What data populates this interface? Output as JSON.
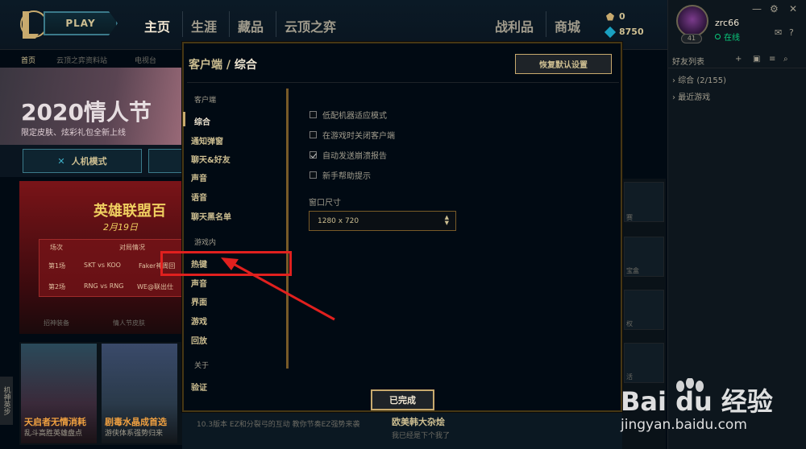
{
  "topbar": {
    "play_label": "PLAY",
    "nav": [
      "主页",
      "生涯",
      "藏品",
      "云顶之弈",
      "战利品",
      "商城"
    ],
    "blue_essence": "0",
    "riot_points": "8750"
  },
  "background": {
    "subnav": [
      "首页",
      "云顶之弈资料站",
      "电视台"
    ],
    "banner_title": "2020情人节",
    "banner_sub": "限定皮肤、炫彩礼包全新上线",
    "mode_button": "人机模式",
    "promo_title": "英雄联盟百",
    "promo_date": "2月19日",
    "promo_table": {
      "headers": [
        "场次",
        "对局情况"
      ],
      "rows": [
        [
          "第1场",
          "SKT vs KOO",
          "Faker神周回"
        ],
        [
          "第2场",
          "RNG vs RNG",
          "WE@联出仕"
        ]
      ]
    },
    "tile_labels": [
      "招神装备",
      "情人节皮肤"
    ],
    "tiles": [
      {
        "title": "天启者无情消耗",
        "sub": "乱斗高胜英雄盘点"
      },
      {
        "title": "剧毒水晶成首选",
        "sub": "游侠体系强势归来"
      }
    ],
    "bottom_text": "10.3版本 EZ和分裂弓的互动 教你节奏EZ强势来袭",
    "bottom_promo": "欧美韩大杂烩",
    "bottom_promo_sub": "我已经是下个我了",
    "left_tab": "机神英步",
    "right_tiles": [
      "赛",
      "宝盒",
      "权",
      "活"
    ]
  },
  "profile": {
    "username": "zrc66",
    "status": "在线",
    "level": "41"
  },
  "friends": {
    "title": "好友列表",
    "groups": [
      "综合 (2/155)",
      "最近游戏"
    ]
  },
  "modal": {
    "breadcrumb_parent": "客户端",
    "breadcrumb_sep": " / ",
    "breadcrumb_current": "综合",
    "reset_label": "恢复默认设置",
    "done_label": "已完成",
    "sections": [
      {
        "title": "客户端",
        "items": [
          "综合",
          "通知弹窗",
          "聊天&好友",
          "声音",
          "语音",
          "聊天黑名单"
        ]
      },
      {
        "title": "游戏内",
        "items": [
          "热键",
          "声音",
          "界面",
          "游戏",
          "回放"
        ]
      },
      {
        "title": "关于",
        "items": [
          "验证"
        ]
      }
    ],
    "options": [
      {
        "label": "低配机器适应模式",
        "checked": false
      },
      {
        "label": "在游戏时关闭客户端",
        "checked": false
      },
      {
        "label": "自动发送崩溃报告",
        "checked": true
      },
      {
        "label": "新手帮助提示",
        "checked": false
      }
    ],
    "window_size_label": "窗口尺寸",
    "window_size_value": "1280 x 720"
  },
  "watermark": {
    "logo_text": "Bai du 经验",
    "url": "jingyan.baidu.com"
  },
  "colors": {
    "gold": "#c8aa6e",
    "highlight": "#e1201e",
    "online": "#0acb7d"
  }
}
